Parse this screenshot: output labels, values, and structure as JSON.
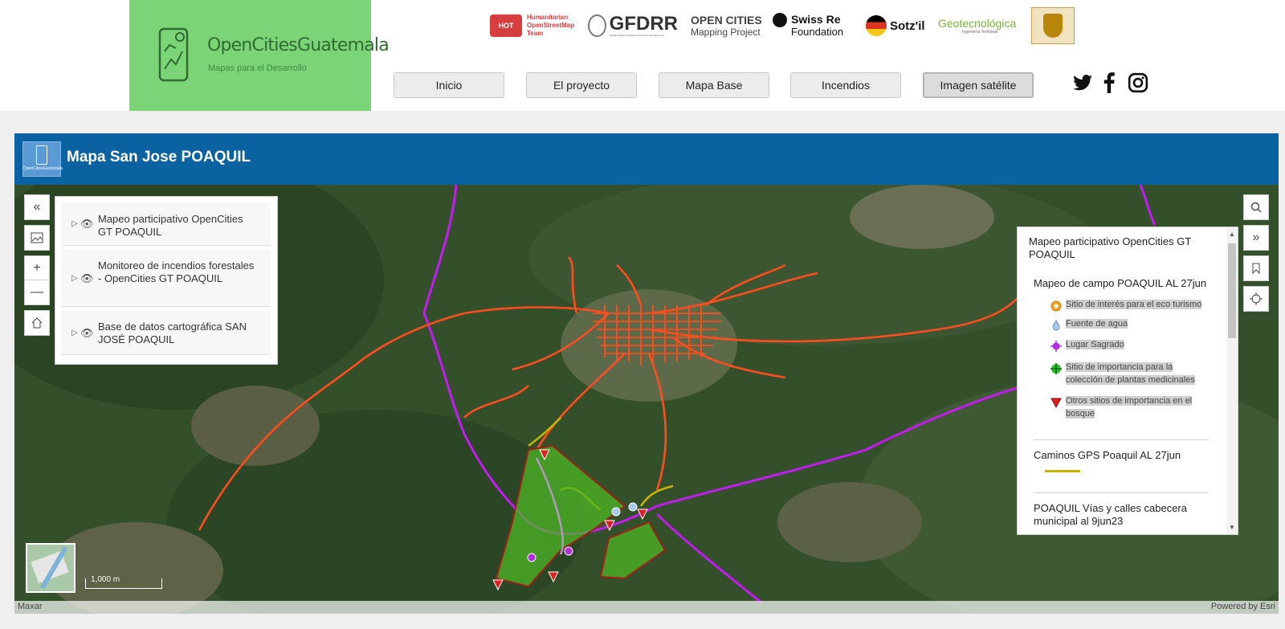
{
  "brand": {
    "title": "OpenCitiesGuatemala",
    "subtitle": "Mapas para el Desarrollo"
  },
  "partners": {
    "hot": "HOT",
    "hot_text": [
      "Humanitarian",
      "OpenStreetMap",
      "Team"
    ],
    "gfdrr": "GFDRR",
    "gfdrr_sub": "Global Facility for Disaster Reduction and Recovery",
    "opencities_1": "OPEN CITIES",
    "opencities_2": "Mapping Project",
    "swissre_1": "Swiss Re",
    "swissre_2": "Foundation",
    "sotzil": "Sotz'il",
    "geo": "Geotecnológica",
    "geo_sub": "Ingeniería Territorial"
  },
  "nav": [
    "Inicio",
    "El proyecto",
    "Mapa Base",
    "Incendios",
    "Imagen satélite"
  ],
  "nav_active": "Imagen satélite",
  "social": [
    "twitter-icon",
    "facebook-icon",
    "instagram-icon"
  ],
  "app": {
    "title": "Mapa San Jose POAQUIL",
    "logo_text": "OpenCitiesGuatemala"
  },
  "layers": [
    {
      "label": "Mapeo participativo OpenCities GT POAQUIL"
    },
    {
      "label": "Monitoreo de incendios forestales - OpenCities GT POAQUIL"
    },
    {
      "label": "Base de datos cartográfica SAN JOSÉ POAQUIL"
    }
  ],
  "legend": {
    "title": "Mapeo participativo OpenCities GT POAQUIL",
    "section1": "Mapeo de campo POAQUIL AL 27jun",
    "items": [
      {
        "label": "Sitio de interés para el eco turismo",
        "icon": "ecotourism-icon",
        "color": "#f5a623"
      },
      {
        "label": "Fuente de agua",
        "icon": "water-drop-icon",
        "color": "#a9c7f0"
      },
      {
        "label": "Lugar Sagrado",
        "icon": "sacred-place-icon",
        "color": "#b42ee0"
      },
      {
        "label": "Sitio de importancia para la colección de plantas medicinales",
        "icon": "medicinal-plants-icon",
        "color": "#2ebd2e"
      },
      {
        "label": "Otros sitios de importancia en el bosque",
        "icon": "forest-site-icon",
        "color": "#e02020"
      }
    ],
    "section2": "Caminos GPS Poaquil AL 27jun",
    "section2_color": "#c8b400",
    "section3": "POAQUIL Vías y calles cabecera municipal al 9jun23"
  },
  "map": {
    "scale": "1,000 m",
    "attribution_left": "Maxar",
    "attribution_right": "Powered by Esri",
    "road_color": "#ff4d1f",
    "boundary_color": "#c21cf0",
    "forest_color": "#4fb526"
  }
}
